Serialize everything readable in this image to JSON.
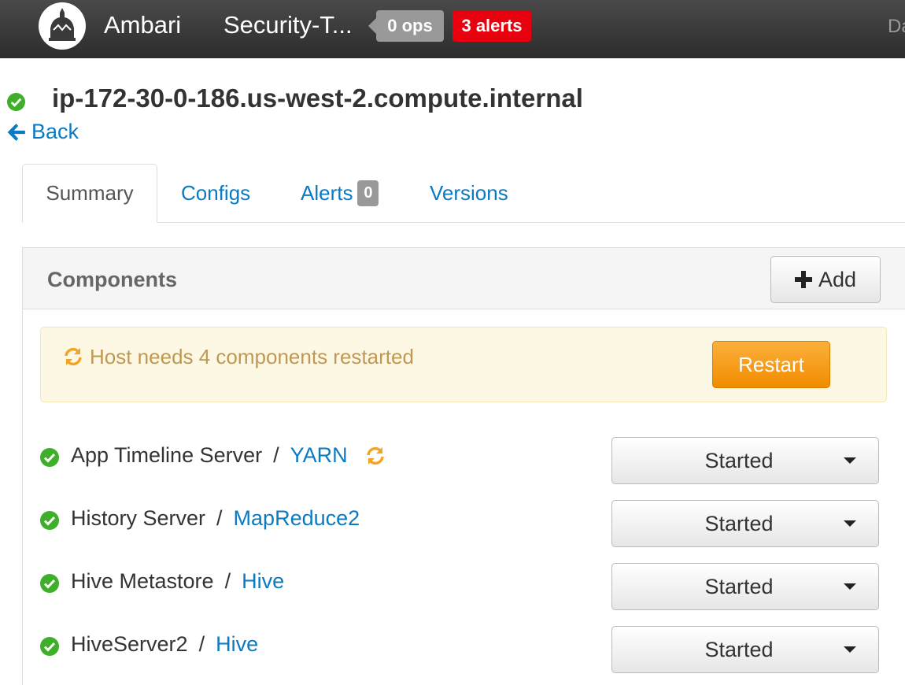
{
  "topbar": {
    "brand": "Ambari",
    "cluster": "Security-T...",
    "ops_badge": "0 ops",
    "alerts_badge": "3 alerts",
    "nav_right": "Da"
  },
  "host": {
    "name": "ip-172-30-0-186.us-west-2.compute.internal",
    "status_color": "#3fae2a",
    "back_label": "Back"
  },
  "tabs": [
    {
      "label": "Summary",
      "active": true
    },
    {
      "label": "Configs"
    },
    {
      "label": "Alerts",
      "badge": "0"
    },
    {
      "label": "Versions"
    }
  ],
  "components": {
    "title": "Components",
    "add_label": "Add",
    "warning_text": "Host needs 4 components restarted",
    "restart_label": "Restart",
    "rows": [
      {
        "name": "App Timeline Server",
        "service": "YARN",
        "status": "Started",
        "needs_restart": true
      },
      {
        "name": "History Server",
        "service": "MapReduce2",
        "status": "Started"
      },
      {
        "name": "Hive Metastore",
        "service": "Hive",
        "status": "Started"
      },
      {
        "name": "HiveServer2",
        "service": "Hive",
        "status": "Started"
      }
    ]
  },
  "colors": {
    "link": "#0a7ac2",
    "ok": "#3fae2a",
    "warning_icon": "#f0a528",
    "alert_red": "#e8000e",
    "restart_orange": "#f7a21d"
  }
}
